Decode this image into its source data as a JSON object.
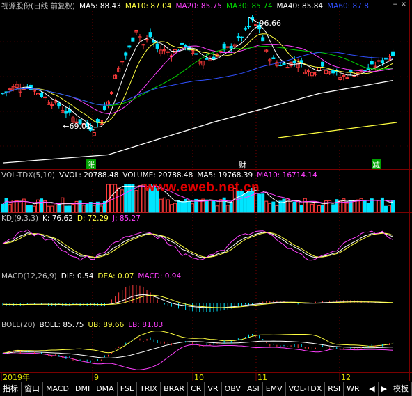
{
  "colors": {
    "bg": "#000000",
    "grid": "#7a0000",
    "up": "#ff3b3b",
    "down": "#00e5ff",
    "white": "#ffffff",
    "yellow": "#ffff40",
    "magenta": "#ff40ff",
    "green": "#00d000",
    "blue": "#3050ff",
    "watermark": "#e00000"
  },
  "main_header": {
    "title": "视源股份(日线 前复权)",
    "items": [
      {
        "label": "MA5: 88.43",
        "color": "#ffffff"
      },
      {
        "label": "MA10: 87.04",
        "color": "#ffff40"
      },
      {
        "label": "MA20: 85.75",
        "color": "#ff40ff"
      },
      {
        "label": "MA30: 85.74",
        "color": "#00d000"
      },
      {
        "label": "MA40: 85.84",
        "color": "#ffffff"
      },
      {
        "label": "MA60: 87.8",
        "color": "#3050ff"
      }
    ]
  },
  "price_annotations": {
    "high": "96.66",
    "low": "69.01"
  },
  "event_tags": [
    {
      "label": "涨",
      "color": "#ffffff",
      "bg": "#00a000"
    },
    {
      "label": "财",
      "color": "#ffffff",
      "bg": "#000000"
    },
    {
      "label": "减",
      "color": "#ffffff",
      "bg": "#00a000"
    }
  ],
  "vol_header": {
    "items": [
      {
        "label": "VOL-TDX(5,10)",
        "color": "#c0c0c0"
      },
      {
        "label": "VVOL: 20788.48",
        "color": "#ffffff"
      },
      {
        "label": "VOLUME: 20788.48",
        "color": "#ffffff"
      },
      {
        "label": "MA5: 19768.39",
        "color": "#ffffff"
      },
      {
        "label": "MA10: 16714.14",
        "color": "#ff40ff"
      }
    ]
  },
  "watermark": "www.eweb.net.cn",
  "kdj_header": {
    "items": [
      {
        "label": "KDJ(9,3,3)",
        "color": "#c0c0c0"
      },
      {
        "label": "K: 76.62",
        "color": "#ffffff"
      },
      {
        "label": "D: 72.29",
        "color": "#ffff40"
      },
      {
        "label": "J: 85.27",
        "color": "#ff40ff"
      }
    ]
  },
  "macd_header": {
    "items": [
      {
        "label": "MACD(12,26,9)",
        "color": "#c0c0c0"
      },
      {
        "label": "DIF: 0.54",
        "color": "#ffffff"
      },
      {
        "label": "DEA: 0.07",
        "color": "#ffff40"
      },
      {
        "label": "MACD: 0.94",
        "color": "#ff40ff"
      }
    ]
  },
  "boll_header": {
    "items": [
      {
        "label": "BOLL(20)",
        "color": "#c0c0c0"
      },
      {
        "label": "BOLL: 85.75",
        "color": "#ffffff"
      },
      {
        "label": "UB: 89.66",
        "color": "#ffff40"
      },
      {
        "label": "LB: 81.83",
        "color": "#ff40ff"
      }
    ]
  },
  "date_axis": [
    "2019年",
    "9",
    "10",
    "11",
    "12"
  ],
  "tabs": [
    "指标",
    "窗口",
    "MACD",
    "DMI",
    "DMA",
    "FSL",
    "TRIX",
    "BRAR",
    "CR",
    "VR",
    "OBV",
    "ASI",
    "EMV",
    "VOL-TDX",
    "RSI",
    "WR"
  ],
  "tab_right": "模板",
  "chart_data": {
    "type": "candlestick",
    "title": "视源股份(日线 前复权)",
    "high": 96.66,
    "low": 69.01,
    "ma": {
      "MA5": 88.43,
      "MA10": 87.04,
      "MA20": 85.75,
      "MA30": 85.74,
      "MA40": 85.84,
      "MA60": 87.8
    },
    "vol": {
      "VVOL": 20788.48,
      "VOLUME": 20788.48,
      "MA5": 19768.39,
      "MA10": 16714.14
    },
    "kdj": {
      "K": 76.62,
      "D": 72.29,
      "J": 85.27
    },
    "macd": {
      "DIF": 0.54,
      "DEA": 0.07,
      "MACD": 0.94
    },
    "boll": {
      "BOLL": 85.75,
      "UB": 89.66,
      "LB": 81.83
    },
    "x_labels": [
      "2019年",
      "9",
      "10",
      "11",
      "12"
    ]
  }
}
